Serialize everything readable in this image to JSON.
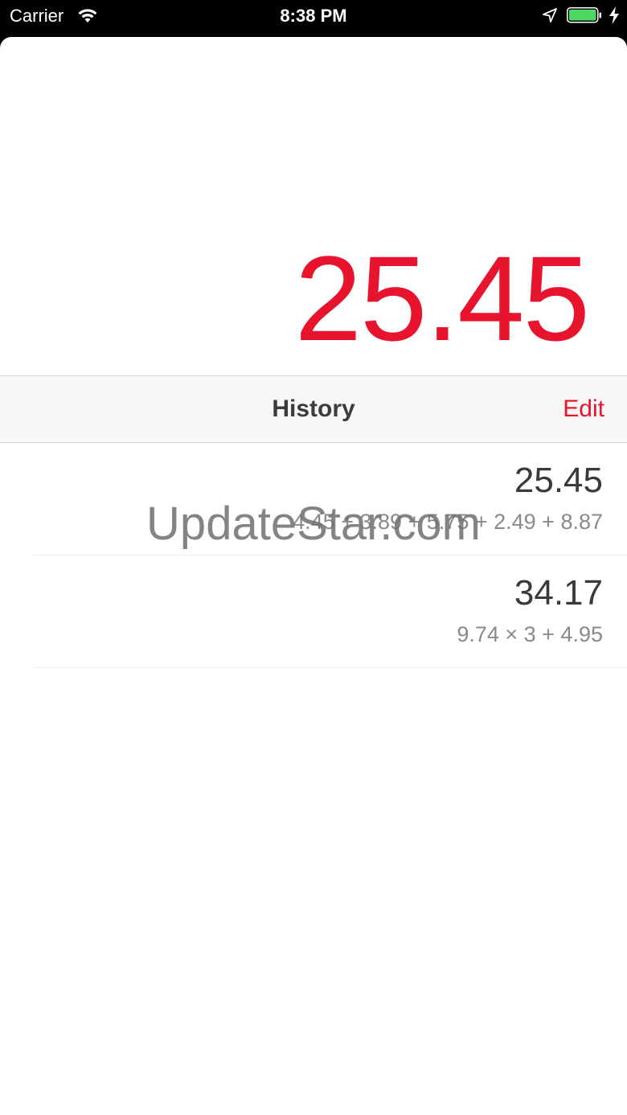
{
  "status_bar": {
    "carrier": "Carrier",
    "time": "8:38 PM",
    "icons": [
      "wifi-icon",
      "location-icon",
      "battery-icon",
      "charging-icon"
    ],
    "battery_color": "#4cd964"
  },
  "display": {
    "value": "25.45",
    "color": "#e8142d"
  },
  "history_bar": {
    "title": "History",
    "edit_label": "Edit"
  },
  "history": [
    {
      "result": "25.45",
      "expression": "4.45 + 3.89 + 5.75 + 2.49 + 8.87"
    },
    {
      "result": "34.17",
      "expression": "9.74 × 3 + 4.95"
    }
  ],
  "watermark": "UpdateStar.com"
}
